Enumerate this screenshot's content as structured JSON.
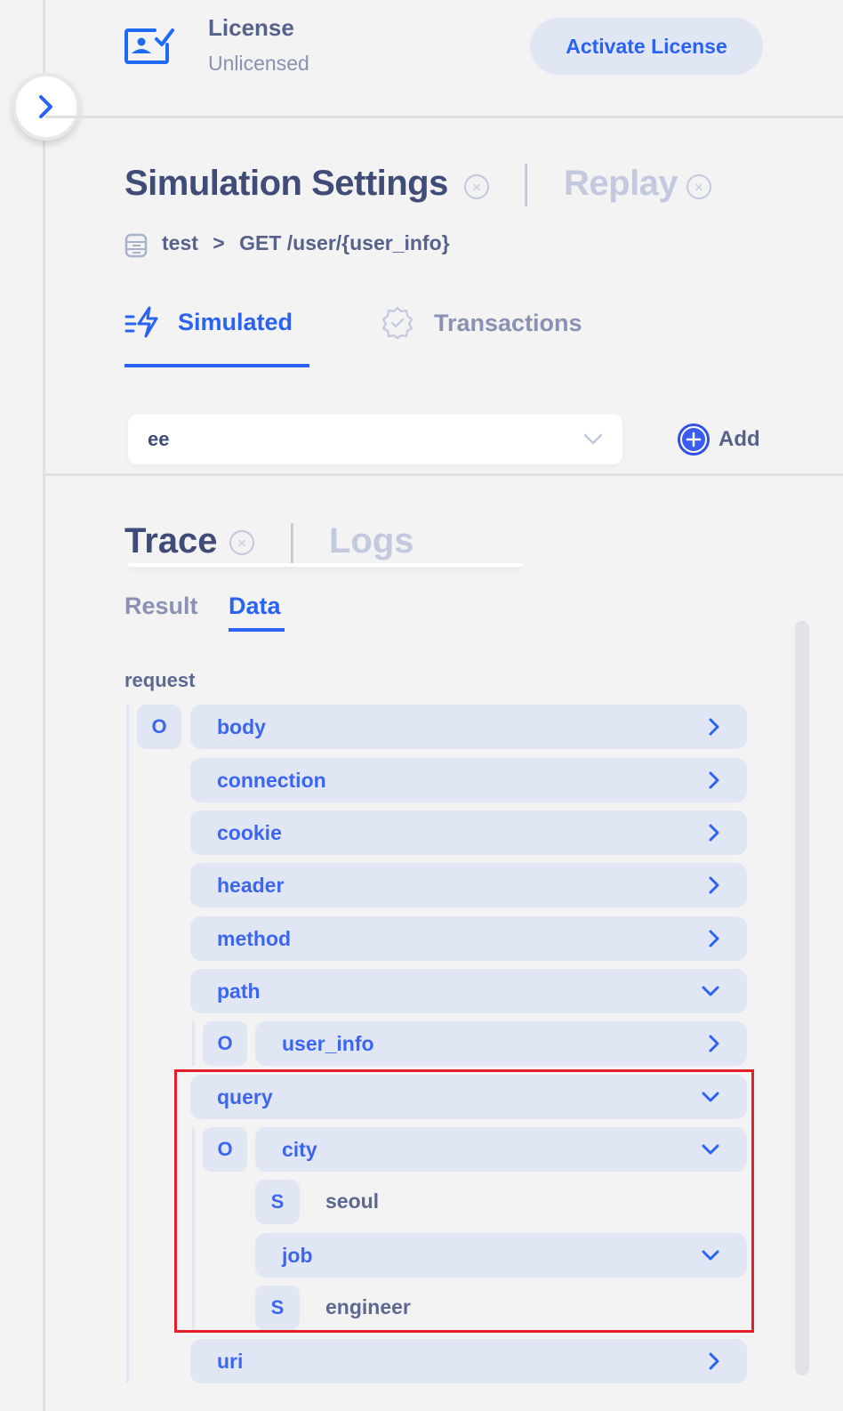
{
  "license": {
    "title": "License",
    "status": "Unlicensed",
    "activate_label": "Activate License"
  },
  "settings_tabs": [
    {
      "label": "Simulation Settings",
      "active": true,
      "closable": true
    },
    {
      "label": "Replay",
      "active": false,
      "closable": true
    }
  ],
  "breadcrumb": {
    "project": "test",
    "separator": ">",
    "endpoint": "GET /user/{user_info}"
  },
  "subtabs": [
    {
      "label": "Simulated",
      "icon": "bolt-lines-icon",
      "active": true
    },
    {
      "label": "Transactions",
      "icon": "badge-check-icon",
      "active": false
    }
  ],
  "scenario_select": {
    "value": "ee"
  },
  "add_label": "Add",
  "trace_tabs": [
    {
      "label": "Trace",
      "active": true,
      "closable": true
    },
    {
      "label": "Logs",
      "active": false,
      "closable": false
    }
  ],
  "result_tabs": [
    {
      "label": "Result",
      "active": false
    },
    {
      "label": "Data",
      "active": true
    }
  ],
  "tree": {
    "root_label": "request",
    "root_type": "O",
    "items": [
      {
        "label": "body",
        "expanded": false
      },
      {
        "label": "connection",
        "expanded": false
      },
      {
        "label": "cookie",
        "expanded": false
      },
      {
        "label": "header",
        "expanded": false
      },
      {
        "label": "method",
        "expanded": false
      },
      {
        "label": "path",
        "expanded": true,
        "children": {
          "type": "O",
          "items": [
            {
              "label": "user_info",
              "expanded": false
            }
          ]
        }
      },
      {
        "label": "query",
        "expanded": true,
        "children": {
          "type": "O",
          "items": [
            {
              "label": "city",
              "expanded": true,
              "value_type": "S",
              "value": "seoul"
            },
            {
              "label": "job",
              "expanded": true,
              "value_type": "S",
              "value": "engineer"
            }
          ]
        }
      },
      {
        "label": "uri",
        "expanded": false
      }
    ]
  },
  "colors": {
    "accent": "#2a62f2",
    "row_bg": "#e1e6f5",
    "title": "#3f4c78",
    "muted": "#8992b2",
    "highlight_box": "#e51f2a"
  }
}
